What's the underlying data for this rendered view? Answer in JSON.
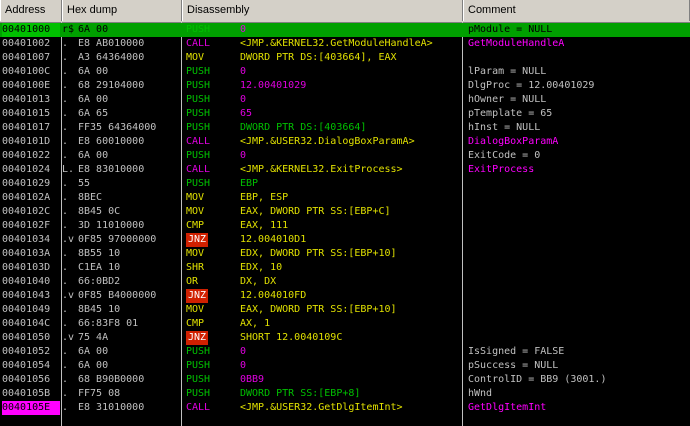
{
  "headers": {
    "address": "Address",
    "hex": "Hex dump",
    "disasm": "Disassembly",
    "comment": "Comment"
  },
  "rows": [
    {
      "addr": "00401000",
      "tick": "r$",
      "hex": "6A 00",
      "mn": "PUSH",
      "ops": "0",
      "mc": "push",
      "oc": "num",
      "cm": "pModule = NULL",
      "sel": true
    },
    {
      "addr": "00401002",
      "tick": ".",
      "hex": "E8 AB010000",
      "mn": "CALL",
      "ops": "<JMP.&KERNEL32.GetModuleHandleA>",
      "mc": "call",
      "oc": "call",
      "cm": "GetModuleHandleA",
      "cc": "call"
    },
    {
      "addr": "00401007",
      "tick": ".",
      "hex": "A3 64364000",
      "mn": "MOV",
      "ops": "DWORD PTR DS:[403664], EAX",
      "mc": "mov",
      "oc": "reg",
      "cm": ""
    },
    {
      "addr": "0040100C",
      "tick": ".",
      "hex": "6A 00",
      "mn": "PUSH",
      "ops": "0",
      "mc": "push",
      "oc": "num",
      "cm": "lParam = NULL"
    },
    {
      "addr": "0040100E",
      "tick": ".",
      "hex": "68 29104000",
      "mn": "PUSH",
      "ops": "12.00401029",
      "mc": "push",
      "oc": "num",
      "cm": "DlgProc = 12.00401029"
    },
    {
      "addr": "00401013",
      "tick": ".",
      "hex": "6A 00",
      "mn": "PUSH",
      "ops": "0",
      "mc": "push",
      "oc": "num",
      "cm": "hOwner = NULL"
    },
    {
      "addr": "00401015",
      "tick": ".",
      "hex": "6A 65",
      "mn": "PUSH",
      "ops": "65",
      "mc": "push",
      "oc": "num",
      "cm": "pTemplate = 65"
    },
    {
      "addr": "00401017",
      "tick": ".",
      "hex": "FF35 64364000",
      "mn": "PUSH",
      "ops": "DWORD PTR DS:[403664]",
      "mc": "push",
      "oc": "dim",
      "cm": "hInst = NULL"
    },
    {
      "addr": "0040101D",
      "tick": ".",
      "hex": "E8 60010000",
      "mn": "CALL",
      "ops": "<JMP.&USER32.DialogBoxParamA>",
      "mc": "call",
      "oc": "call",
      "cm": "DialogBoxParamA",
      "cc": "call"
    },
    {
      "addr": "00401022",
      "tick": ".",
      "hex": "6A 00",
      "mn": "PUSH",
      "ops": "0",
      "mc": "push",
      "oc": "num",
      "cm": "ExitCode = 0"
    },
    {
      "addr": "00401024",
      "tick": "L.",
      "hex": "E8 83010000",
      "mn": "CALL",
      "ops": "<JMP.&KERNEL32.ExitProcess>",
      "mc": "call",
      "oc": "call",
      "cm": "ExitProcess",
      "cc": "call"
    },
    {
      "addr": "00401029",
      "tick": ".",
      "hex": "55",
      "mn": "PUSH",
      "ops": "EBP",
      "mc": "push",
      "oc": "dim",
      "cm": ""
    },
    {
      "addr": "0040102A",
      "tick": ".",
      "hex": "8BEC",
      "mn": "MOV",
      "ops": "EBP, ESP",
      "mc": "mov",
      "oc": "reg",
      "cm": ""
    },
    {
      "addr": "0040102C",
      "tick": ".",
      "hex": "8B45 0C",
      "mn": "MOV",
      "ops": "EAX, DWORD PTR SS:[EBP+C]",
      "mc": "mov",
      "oc": "reg",
      "cm": ""
    },
    {
      "addr": "0040102F",
      "tick": ".",
      "hex": "3D 11010000",
      "mn": "CMP",
      "ops": "EAX, 111",
      "mc": "mov",
      "oc": "reg",
      "cm": ""
    },
    {
      "addr": "00401034",
      "tick": ".v",
      "hex": "0F85 97000000",
      "mn": "JNZ",
      "ops": "12.004010D1",
      "mc": "jnz",
      "oc": "reg",
      "cm": ""
    },
    {
      "addr": "0040103A",
      "tick": ".",
      "hex": "8B55 10",
      "mn": "MOV",
      "ops": "EDX, DWORD PTR SS:[EBP+10]",
      "mc": "mov",
      "oc": "reg",
      "cm": ""
    },
    {
      "addr": "0040103D",
      "tick": ".",
      "hex": "C1EA 10",
      "mn": "SHR",
      "ops": "EDX, 10",
      "mc": "mov",
      "oc": "reg",
      "cm": ""
    },
    {
      "addr": "00401040",
      "tick": ".",
      "hex": "66:0BD2",
      "mn": "OR",
      "ops": "DX, DX",
      "mc": "mov",
      "oc": "reg",
      "cm": ""
    },
    {
      "addr": "00401043",
      "tick": ".v",
      "hex": "0F85 B4000000",
      "mn": "JNZ",
      "ops": "12.004010FD",
      "mc": "jnz",
      "oc": "reg",
      "cm": ""
    },
    {
      "addr": "00401049",
      "tick": ".",
      "hex": "8B45 10",
      "mn": "MOV",
      "ops": "EAX, DWORD PTR SS:[EBP+10]",
      "mc": "mov",
      "oc": "reg",
      "cm": ""
    },
    {
      "addr": "0040104C",
      "tick": ".",
      "hex": "66:83F8 01",
      "mn": "CMP",
      "ops": "AX, 1",
      "mc": "mov",
      "oc": "reg",
      "cm": ""
    },
    {
      "addr": "00401050",
      "tick": ".v",
      "hex": "75 4A",
      "mn": "JNZ",
      "ops": "SHORT 12.0040109C",
      "mc": "jnz",
      "oc": "reg",
      "cm": ""
    },
    {
      "addr": "00401052",
      "tick": ".",
      "hex": "6A 00",
      "mn": "PUSH",
      "ops": "0",
      "mc": "push",
      "oc": "num",
      "cm": "IsSigned = FALSE"
    },
    {
      "addr": "00401054",
      "tick": ".",
      "hex": "6A 00",
      "mn": "PUSH",
      "ops": "0",
      "mc": "push",
      "oc": "num",
      "cm": "pSuccess = NULL"
    },
    {
      "addr": "00401056",
      "tick": ".",
      "hex": "68 B90B0000",
      "mn": "PUSH",
      "ops": "0BB9",
      "mc": "push",
      "oc": "num",
      "cm": "ControlID = BB9 (3001.)"
    },
    {
      "addr": "0040105B",
      "tick": ".",
      "hex": "FF75 08",
      "mn": "PUSH",
      "ops": "DWORD PTR SS:[EBP+8]",
      "mc": "push",
      "oc": "dim",
      "cm": "hWnd"
    },
    {
      "addr": "0040105E",
      "tick": ".",
      "hex": "E8 31010000",
      "mn": "CALL",
      "ops": "<JMP.&USER32.GetDlgItemInt>",
      "mc": "call",
      "oc": "call",
      "cm": "GetDlgItemInt",
      "cc": "call",
      "eip": true
    }
  ],
  "colors": {
    "selection": "#00c000",
    "eip": "#ff00ff",
    "push": "#00c000",
    "call": "#e000e0",
    "jnz_bg": "#d02000"
  }
}
